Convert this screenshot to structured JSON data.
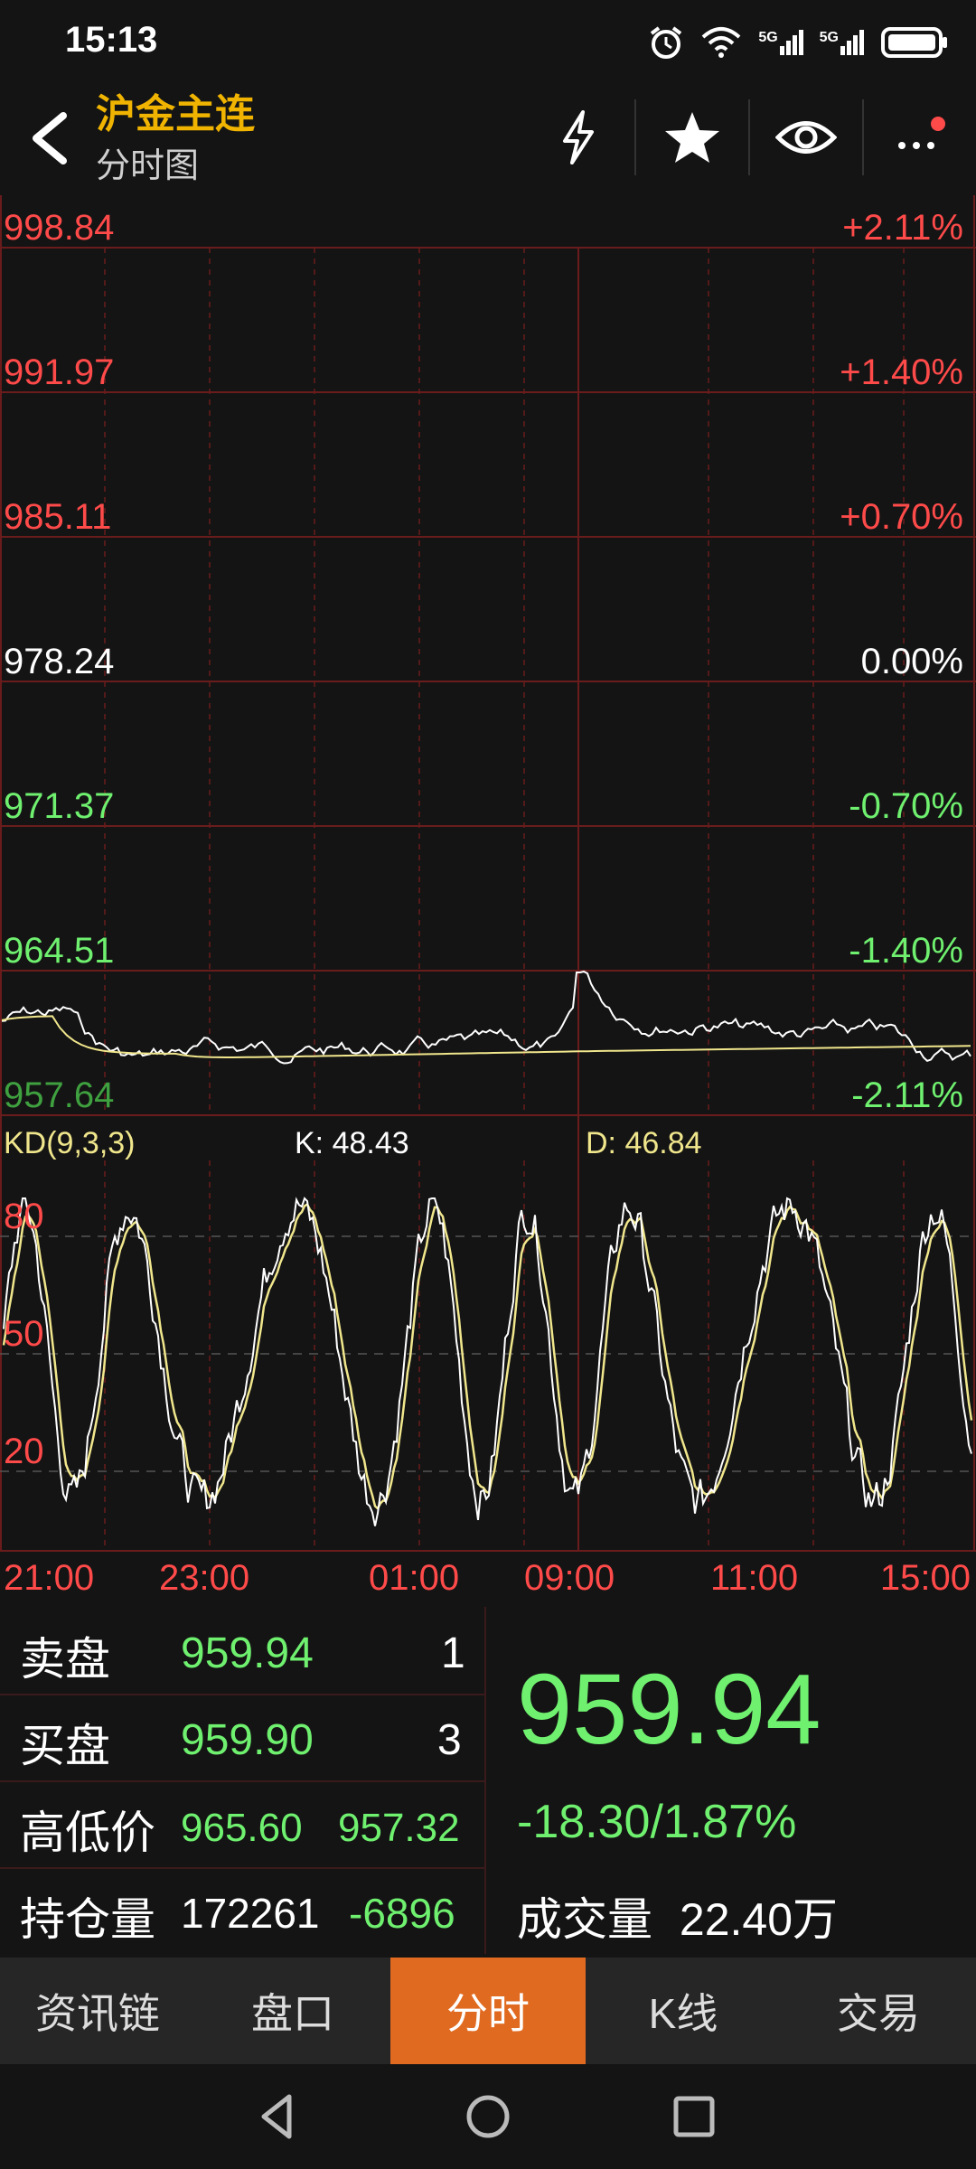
{
  "status_bar": {
    "time": "15:13",
    "icons": [
      "alarm-icon",
      "wifi-icon",
      "signal-5g-icon",
      "signal-5g-icon",
      "battery-icon"
    ],
    "net1": "5G",
    "net2": "5G"
  },
  "header": {
    "title": "沪金主连",
    "subtitle": "分时图",
    "icons": [
      "back-icon",
      "flash-icon",
      "star-icon",
      "eye-icon",
      "more-icon"
    ]
  },
  "price_axis": {
    "prices": [
      "998.84",
      "991.97",
      "985.11",
      "978.24",
      "971.37",
      "964.51",
      "957.64"
    ],
    "percents": [
      "+2.11%",
      "+1.40%",
      "+0.70%",
      "0.00%",
      "-0.70%",
      "-1.40%",
      "-2.11%"
    ]
  },
  "kd": {
    "label": "KD(9,3,3)",
    "k": "K: 48.43",
    "d": "D: 46.84",
    "levels": [
      "80",
      "50",
      "20"
    ]
  },
  "time_axis": [
    "21:00",
    "23:00",
    "01:00",
    "09:00",
    "11:00",
    "15:00"
  ],
  "quote": {
    "sell_label": "卖盘",
    "sell_price": "959.94",
    "sell_qty": "1",
    "buy_label": "买盘",
    "buy_price": "959.90",
    "buy_qty": "3",
    "hl_label": "高低价",
    "high": "965.60",
    "low": "957.32",
    "oi_label": "持仓量",
    "oi": "172261",
    "oi_change": "-6896",
    "last_price": "959.94",
    "change": "-18.30/1.87%",
    "vol_label": "成交量",
    "volume": "22.40万"
  },
  "tabs": [
    {
      "label": "资讯链",
      "active": false
    },
    {
      "label": "盘口",
      "active": false
    },
    {
      "label": "分时",
      "active": true
    },
    {
      "label": "K线",
      "active": false
    },
    {
      "label": "交易",
      "active": false
    }
  ],
  "colors": {
    "up": "#ff4a4a",
    "down": "#6ff06f",
    "flat": "#ffffff",
    "accent": "#e06a20",
    "title": "#f0b400",
    "avg_line": "#f0e68c"
  }
}
